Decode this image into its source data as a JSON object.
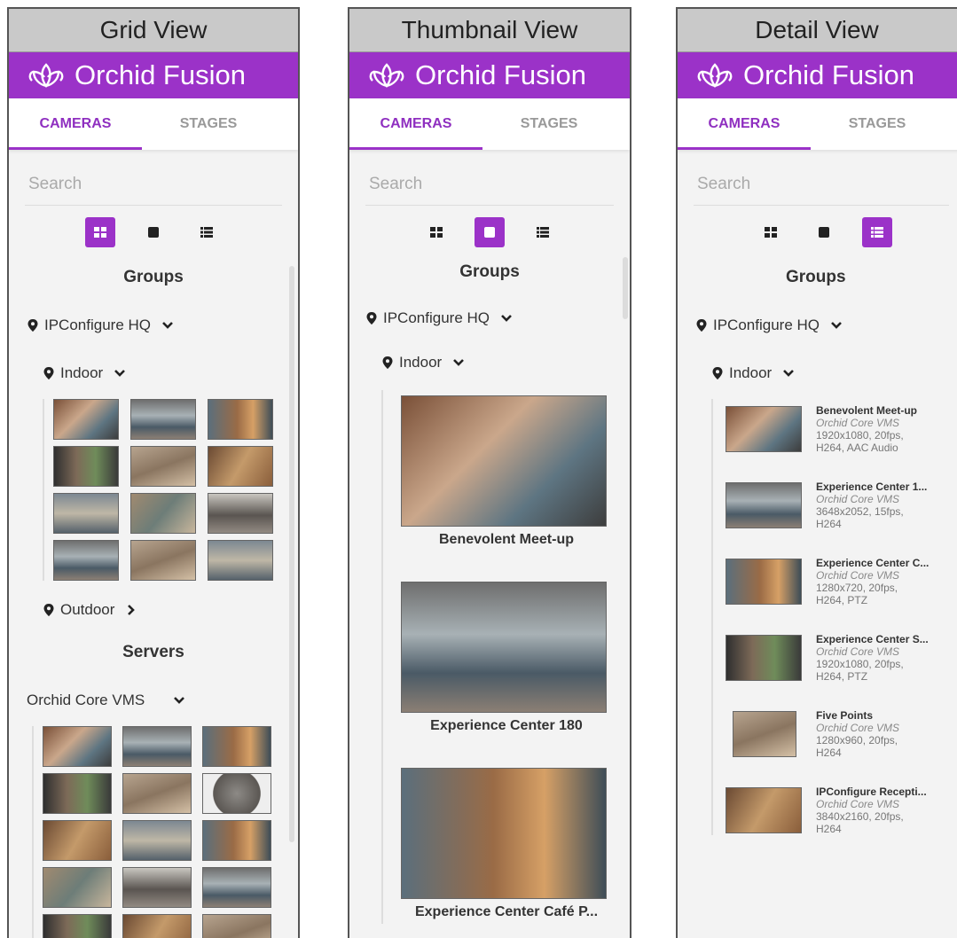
{
  "panels": [
    {
      "caption": "Grid View",
      "brand": "Orchid Fusion",
      "tabs": [
        "CAMERAS",
        "STAGES"
      ],
      "search_placeholder": "Search",
      "groups_title": "Groups",
      "group_root": "IPConfigure HQ",
      "group_indoor": "Indoor",
      "group_outdoor": "Outdoor",
      "servers_title": "Servers",
      "server_name": "Orchid Core VMS"
    },
    {
      "caption": "Thumbnail View",
      "brand": "Orchid Fusion",
      "tabs": [
        "CAMERAS",
        "STAGES"
      ],
      "search_placeholder": "Search",
      "groups_title": "Groups",
      "group_root": "IPConfigure HQ",
      "group_indoor": "Indoor",
      "cameras": [
        "Benevolent Meet-up",
        "Experience Center 180",
        "Experience Center Café P..."
      ]
    },
    {
      "caption": "Detail View",
      "brand": "Orchid Fusion",
      "tabs": [
        "CAMERAS",
        "STAGES"
      ],
      "search_placeholder": "Search",
      "groups_title": "Groups",
      "group_root": "IPConfigure HQ",
      "group_indoor": "Indoor",
      "cameras": [
        {
          "name": "Benevolent Meet-up",
          "server": "Orchid Core VMS",
          "specs": "1920x1080, 20fps, H264, AAC Audio"
        },
        {
          "name": "Experience Center 1...",
          "server": "Orchid Core VMS",
          "specs": "3648x2052, 15fps, H264"
        },
        {
          "name": "Experience Center C...",
          "server": "Orchid Core VMS",
          "specs": "1280x720, 20fps, H264, PTZ"
        },
        {
          "name": "Experience Center S...",
          "server": "Orchid Core VMS",
          "specs": "1920x1080, 20fps, H264, PTZ"
        },
        {
          "name": "Five Points",
          "server": "Orchid Core VMS",
          "specs": "1280x960, 20fps, H264"
        },
        {
          "name": "IPConfigure Recepti...",
          "server": "Orchid Core VMS",
          "specs": "3840x2160, 20fps, H264"
        }
      ]
    }
  ],
  "colors": {
    "brand": "#9b32c8",
    "active_tab": "#8f2fc0"
  }
}
